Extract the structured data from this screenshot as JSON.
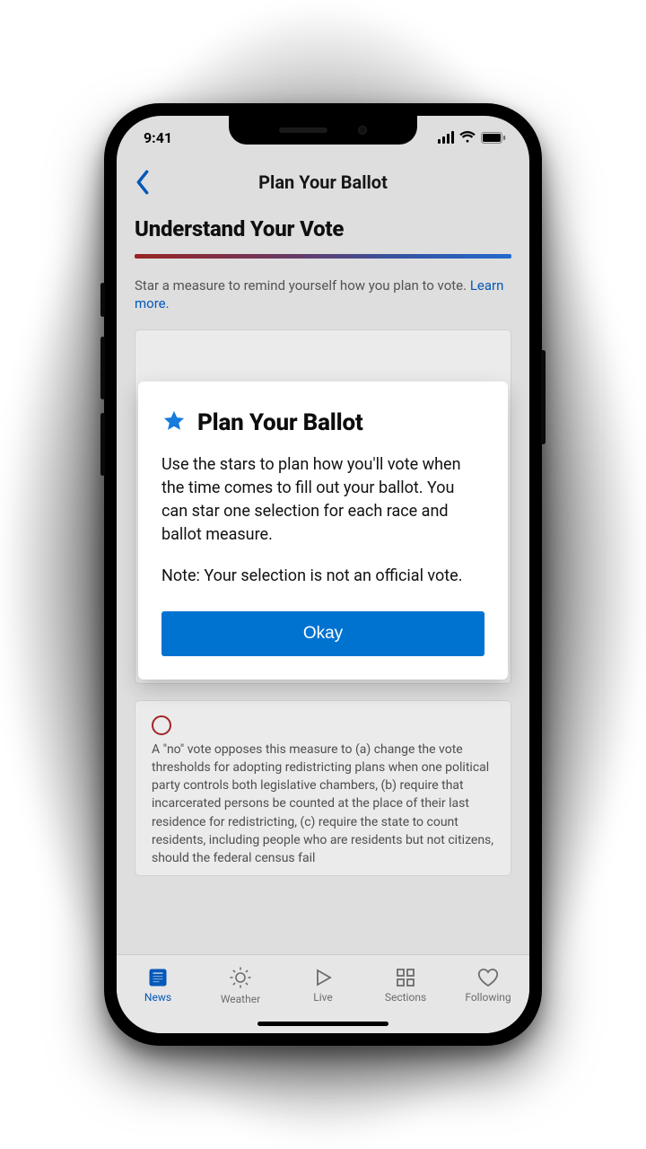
{
  "status": {
    "time": "9:41"
  },
  "header": {
    "title": "Plan Your Ballot"
  },
  "section": {
    "heading": "Understand Your Vote",
    "hint": "Star a measure to remind yourself how you plan to vote.",
    "learn_more": "Learn more."
  },
  "measure_no_vote_text": "A \"no\" vote opposes this measure to (a) change the vote thresholds for adopting redistricting plans when one political party controls both legislative chambers, (b) require that incarcerated persons be counted at the place of their last residence for redistricting, (c) require the state to count residents, including people who are residents but not citizens, should the federal census fail",
  "modal": {
    "title": "Plan Your Ballot",
    "body1": "Use the stars to plan how you'll vote when the time comes to fill out your ballot. You can star one selection for each race and ballot measure.",
    "body2": "Note: Your selection is not an official vote.",
    "okay": "Okay"
  },
  "tabs": {
    "news": "News",
    "weather": "Weather",
    "live": "Live",
    "sections": "Sections",
    "following": "Following"
  }
}
